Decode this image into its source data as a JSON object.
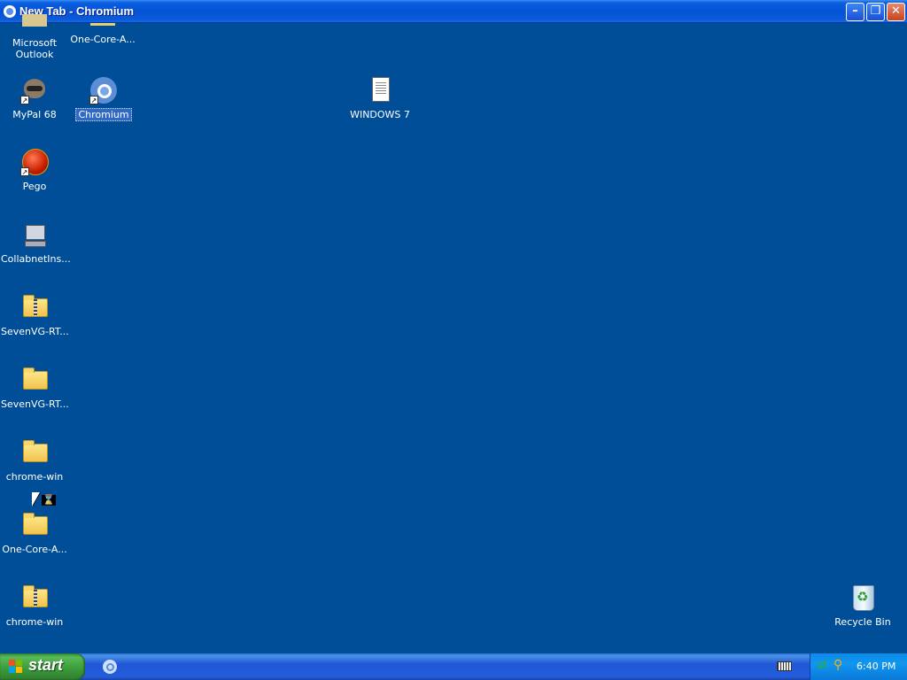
{
  "window": {
    "title": "New Tab - Chromium",
    "buttons": {
      "minimize": "–",
      "maximize": "❐",
      "close": "✕"
    }
  },
  "desktop": {
    "icons": [
      {
        "id": "microsoft-outlook",
        "label": "Microsoft\nOutlook",
        "icon": "outlook-icon"
      },
      {
        "id": "one-core-a-top",
        "label": "One-Core-A...",
        "icon": "folder-icon"
      },
      {
        "id": "mypal",
        "label": "MyPal 68",
        "icon": "mypal-icon"
      },
      {
        "id": "chromium",
        "label": "Chromium",
        "icon": "chromium-icon",
        "selected": true
      },
      {
        "id": "windows7",
        "label": "WINDOWS 7",
        "icon": "text-document-icon"
      },
      {
        "id": "pego",
        "label": "Pego",
        "icon": "pego-icon"
      },
      {
        "id": "collabnet",
        "label": "CollabnetIns...",
        "icon": "installer-icon"
      },
      {
        "id": "sevenvg-zip",
        "label": "SevenVG-RT...",
        "icon": "zip-folder-icon"
      },
      {
        "id": "sevenvg-folder",
        "label": "SevenVG-RT...",
        "icon": "folder-icon"
      },
      {
        "id": "chrome-win-folder",
        "label": "chrome-win",
        "icon": "folder-icon"
      },
      {
        "id": "one-core-a",
        "label": "One-Core-A...",
        "icon": "folder-icon"
      },
      {
        "id": "chrome-win-zip",
        "label": "chrome-win",
        "icon": "zip-folder-icon"
      },
      {
        "id": "recycle-bin",
        "label": "Recycle Bin",
        "icon": "recycle-bin-icon"
      }
    ]
  },
  "taskbar": {
    "start_label": "start",
    "clock": "6:40 PM",
    "tray_icons": [
      "network-icon",
      "search-icon"
    ],
    "quick_icons": [
      "chromium-taskbar-icon",
      "keyboard-icon"
    ]
  },
  "colors": {
    "desktop": "#004e98",
    "taskbar": "#245edb",
    "start": "#3a9a3a",
    "tray": "#1196ee"
  }
}
